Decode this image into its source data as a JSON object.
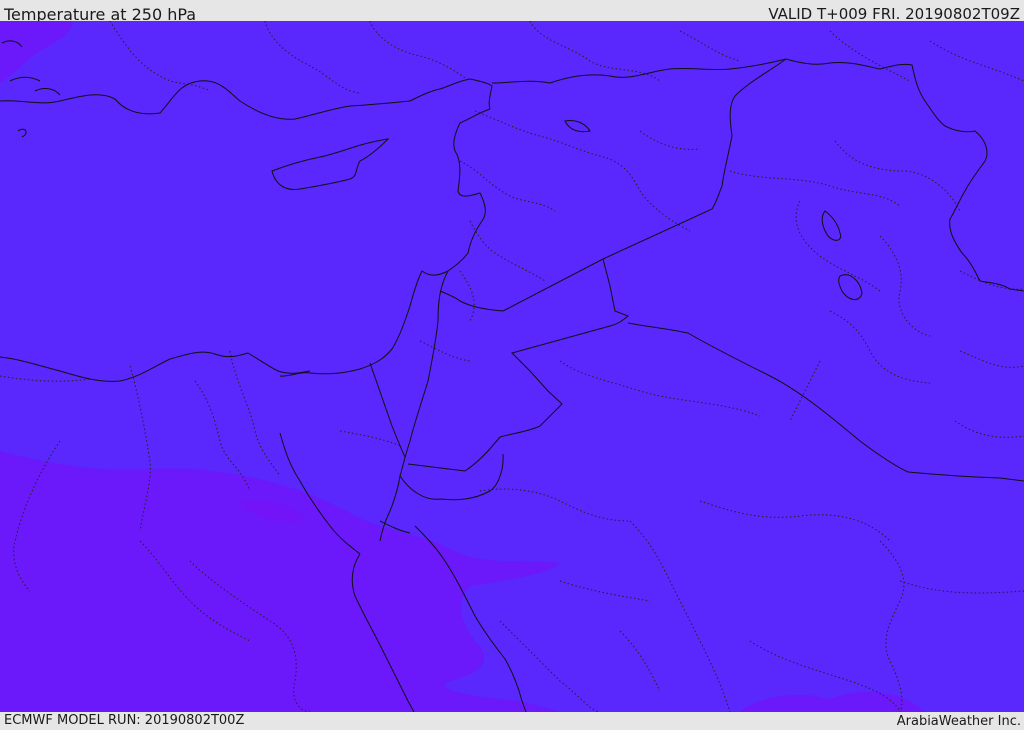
{
  "header": {
    "title": "Temperature at 250 hPa",
    "valid": "VALID T+009 FRI. 20190802T09Z"
  },
  "footer": {
    "model_run": "ECMWF MODEL RUN: 20190802T00Z",
    "credit": "ArabiaWeather Inc."
  },
  "map": {
    "colors": {
      "field_main": "#5a27fc",
      "field_warm": "#6b18fb",
      "field_warm_spot": "#7314f8",
      "border_line": "#111111",
      "province_line": "#222222"
    }
  }
}
